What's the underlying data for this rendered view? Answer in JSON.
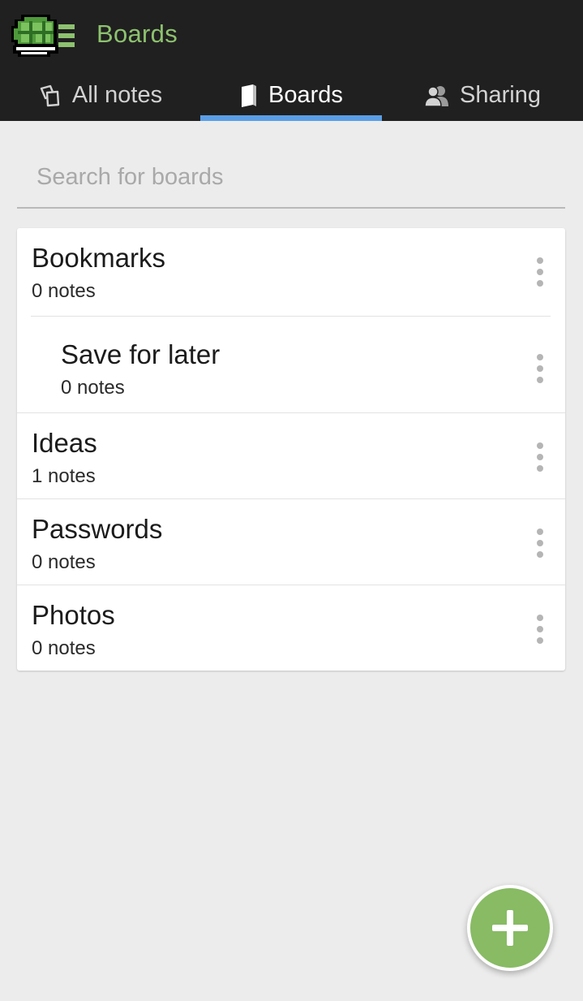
{
  "app": {
    "title": "Boards",
    "accent_color": "#8dc26f",
    "tab_indicator_color": "#5b9ee6",
    "fab_color": "#88bb64"
  },
  "tabs": [
    {
      "label": "All notes",
      "icon": "notes-icon",
      "active": false
    },
    {
      "label": "Boards",
      "icon": "book-icon",
      "active": true
    },
    {
      "label": "Sharing",
      "icon": "people-icon",
      "active": false
    }
  ],
  "search": {
    "placeholder": "Search for boards",
    "value": ""
  },
  "boards": [
    {
      "name": "Bookmarks",
      "count": "0 notes"
    },
    {
      "name": "Save for later",
      "count": "0 notes",
      "nested": true
    },
    {
      "name": "Ideas",
      "count": "1 notes"
    },
    {
      "name": "Passwords",
      "count": "0 notes"
    },
    {
      "name": "Photos",
      "count": "0 notes"
    }
  ],
  "fab": {
    "icon": "plus-icon"
  }
}
